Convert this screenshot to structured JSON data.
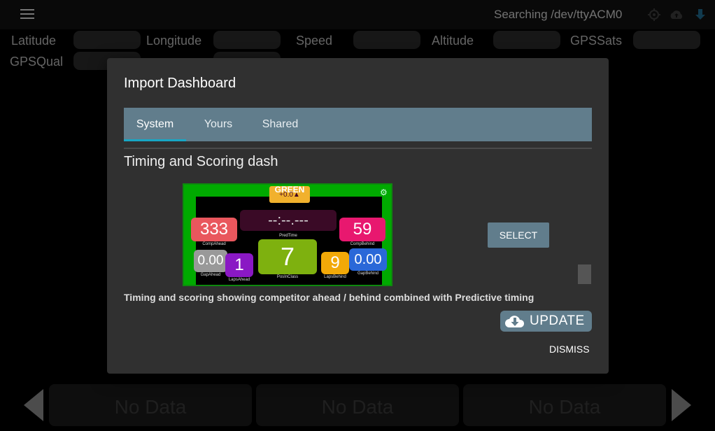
{
  "topbar": {
    "status": "Searching /dev/ttyACM0",
    "icons": [
      "menu-icon",
      "gps-icon",
      "cloud-upload-icon",
      "download-icon"
    ]
  },
  "gauges": {
    "row1": [
      "Latitude",
      "Longitude",
      "Speed",
      "Altitude",
      "GPSSats"
    ],
    "row2": [
      "GPSQual"
    ]
  },
  "bottom": {
    "panels": [
      "No Data",
      "No Data",
      "No Data"
    ]
  },
  "dialog": {
    "title": "Import Dashboard",
    "tabs": [
      {
        "label": "System",
        "active": true
      },
      {
        "label": "Yours",
        "active": false
      },
      {
        "label": "Shared",
        "active": false
      }
    ],
    "item": {
      "title": "Timing and Scoring dash",
      "description": "Timing and scoring showing competitor ahead / behind combined with Predictive timing",
      "select_label": "SELECT",
      "preview": {
        "banner": "GREEN",
        "banner_sub": "+0.0▲",
        "pred_time": "--:--.---",
        "pred_time_caption": "PredTime",
        "comp_ahead": "333",
        "comp_ahead_caption": "CompAhead",
        "comp_behind": "59",
        "comp_behind_caption": "CompBehind",
        "gap_ahead": "0.00",
        "gap_ahead_caption": "GapAhead",
        "laps_ahead": "1",
        "laps_ahead_caption": "LapsAhead",
        "pos_class": "7",
        "pos_class_caption": "PosInClass",
        "laps_behind": "9",
        "laps_behind_caption": "LapsBehind",
        "gap_behind": "0.00",
        "gap_behind_caption": "GapBehind"
      }
    },
    "update_label": "UPDATE",
    "dismiss_label": "DISMISS"
  },
  "colors": {
    "accent": "#617d8c",
    "tab_indicator": "#18a6c4",
    "dialog_bg": "#303030",
    "preview_green": "#00aa00"
  }
}
